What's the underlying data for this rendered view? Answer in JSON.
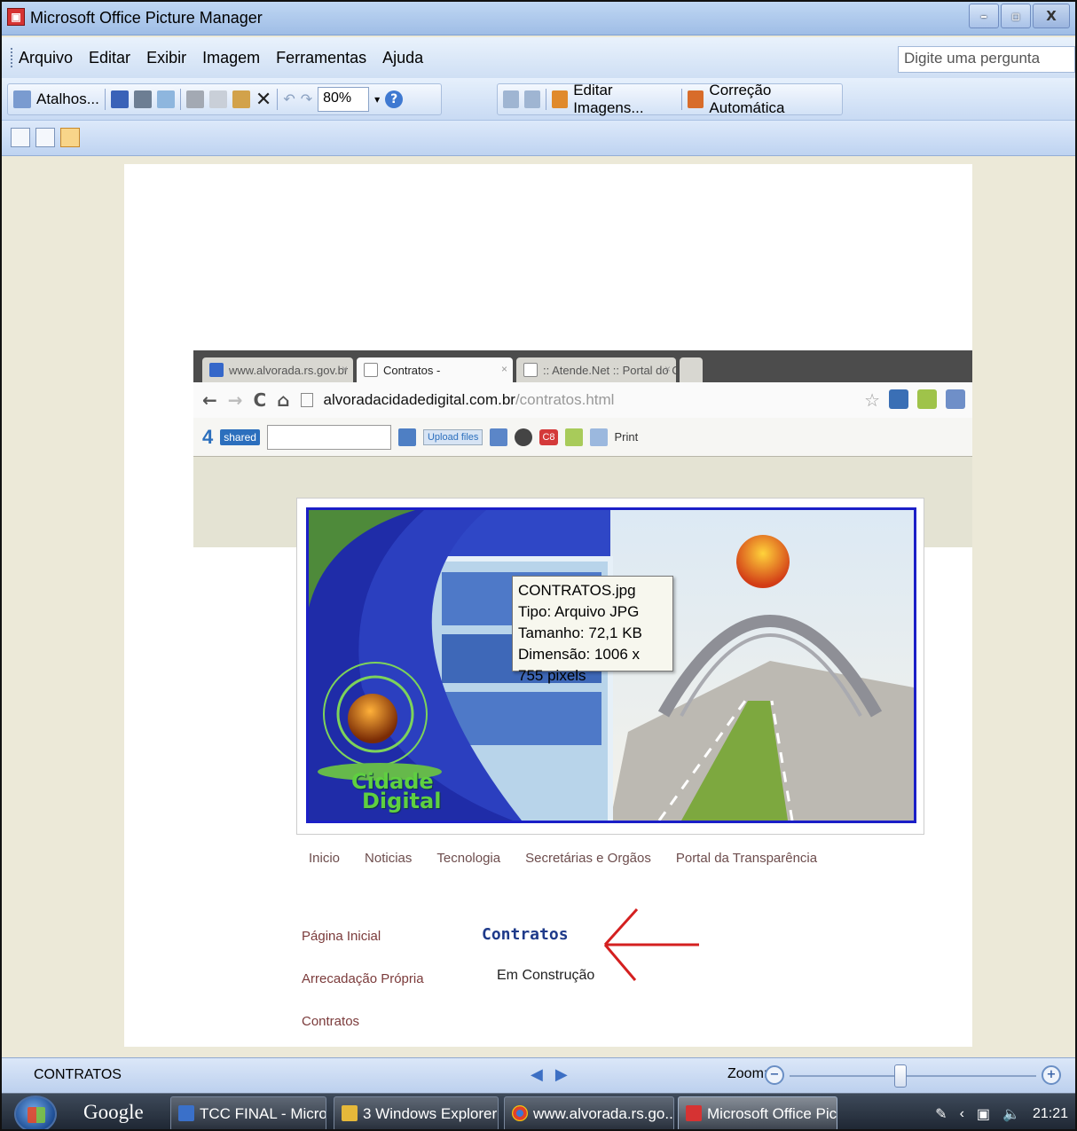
{
  "window": {
    "title": "Microsoft Office Picture Manager",
    "controls": [
      "–",
      "▫",
      "X"
    ]
  },
  "menu": {
    "items": [
      "Arquivo",
      "Editar",
      "Exibir",
      "Imagem",
      "Ferramentas",
      "Ajuda"
    ],
    "help_placeholder": "Digite uma pergunta"
  },
  "toolbar": {
    "shortcuts_label": "Atalhos...",
    "zoom_value": "80%",
    "edit_images_label": "Editar Imagens...",
    "auto_correct_label": "Correção Automática"
  },
  "browser": {
    "tabs": [
      "www.alvorada.rs.gov.br",
      "Contratos -",
      ":: Atende.Net :: Portal do C"
    ],
    "url_host": "alvoradacidadedigital.com.br",
    "url_path": "/contratos.html",
    "share_logo": "4",
    "share_badge": "shared",
    "upload_label": "Upload files",
    "print_label": "Print",
    "badge_c8": "C8"
  },
  "banner": {
    "logo_line1": "Cidade",
    "logo_line2": "Digital"
  },
  "tooltip": {
    "name": "CONTRATOS.jpg",
    "type": "Tipo: Arquivo JPG",
    "size": "Tamanho: 72,1 KB",
    "dimension": "Dimensão: 1006 x 755 pixels"
  },
  "site": {
    "nav": [
      "Inicio",
      "Noticias",
      "Tecnologia",
      "Secretárias e Orgãos",
      "Portal da Transparência"
    ],
    "side_links": [
      "Página Inicial",
      "Arrecadação Própria",
      "Contratos"
    ],
    "content_title": "Contratos",
    "content_text": "Em Construção"
  },
  "status": {
    "filename": "CONTRATOS",
    "zoom_label": "Zoom:",
    "zoom_fraction": 0.45
  },
  "taskbar": {
    "google": "Google",
    "buttons": [
      "TCC FINAL - Micros...",
      "3 Windows Explorer",
      "www.alvorada.rs.go...",
      "Microsoft Office Pic..."
    ],
    "clock": "21:21"
  },
  "colors": {
    "accent_blue": "#1b1fc7",
    "annotation_red": "#d42020",
    "link_brown": "#7b3b3b"
  }
}
